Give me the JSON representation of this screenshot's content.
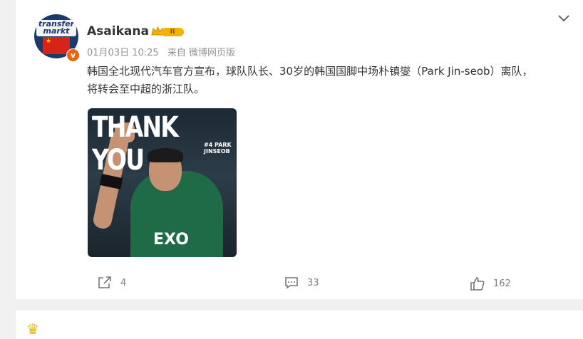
{
  "post": {
    "username": "Asaikana",
    "vip_level": "II",
    "avatar_logo_text": "transfer markt",
    "verified_badge": "v",
    "date": "01月03日 10:25",
    "source": "来自 微博网页版",
    "content": "韩国全北现代汽车官方宣布，球队队长、30岁的韩国国脚中场朴镇燮（Park Jin-seob）离队，将转会至中超的浙江队。",
    "image": {
      "headline": "THANK YOU",
      "subtitle": "#4 PARK JINSEOB",
      "sponsor": "EXO"
    },
    "actions": {
      "share_count": "4",
      "comment_count": "33",
      "like_count": "162"
    }
  },
  "icons": {
    "more": "chevron-down-icon",
    "share": "share-icon",
    "comment": "comment-icon",
    "like": "thumbs-up-icon",
    "vip": "crown-icon"
  },
  "colors": {
    "vip_gold": "#f2b400",
    "verified_orange": "#e8670e",
    "meta_gray": "#939393"
  }
}
